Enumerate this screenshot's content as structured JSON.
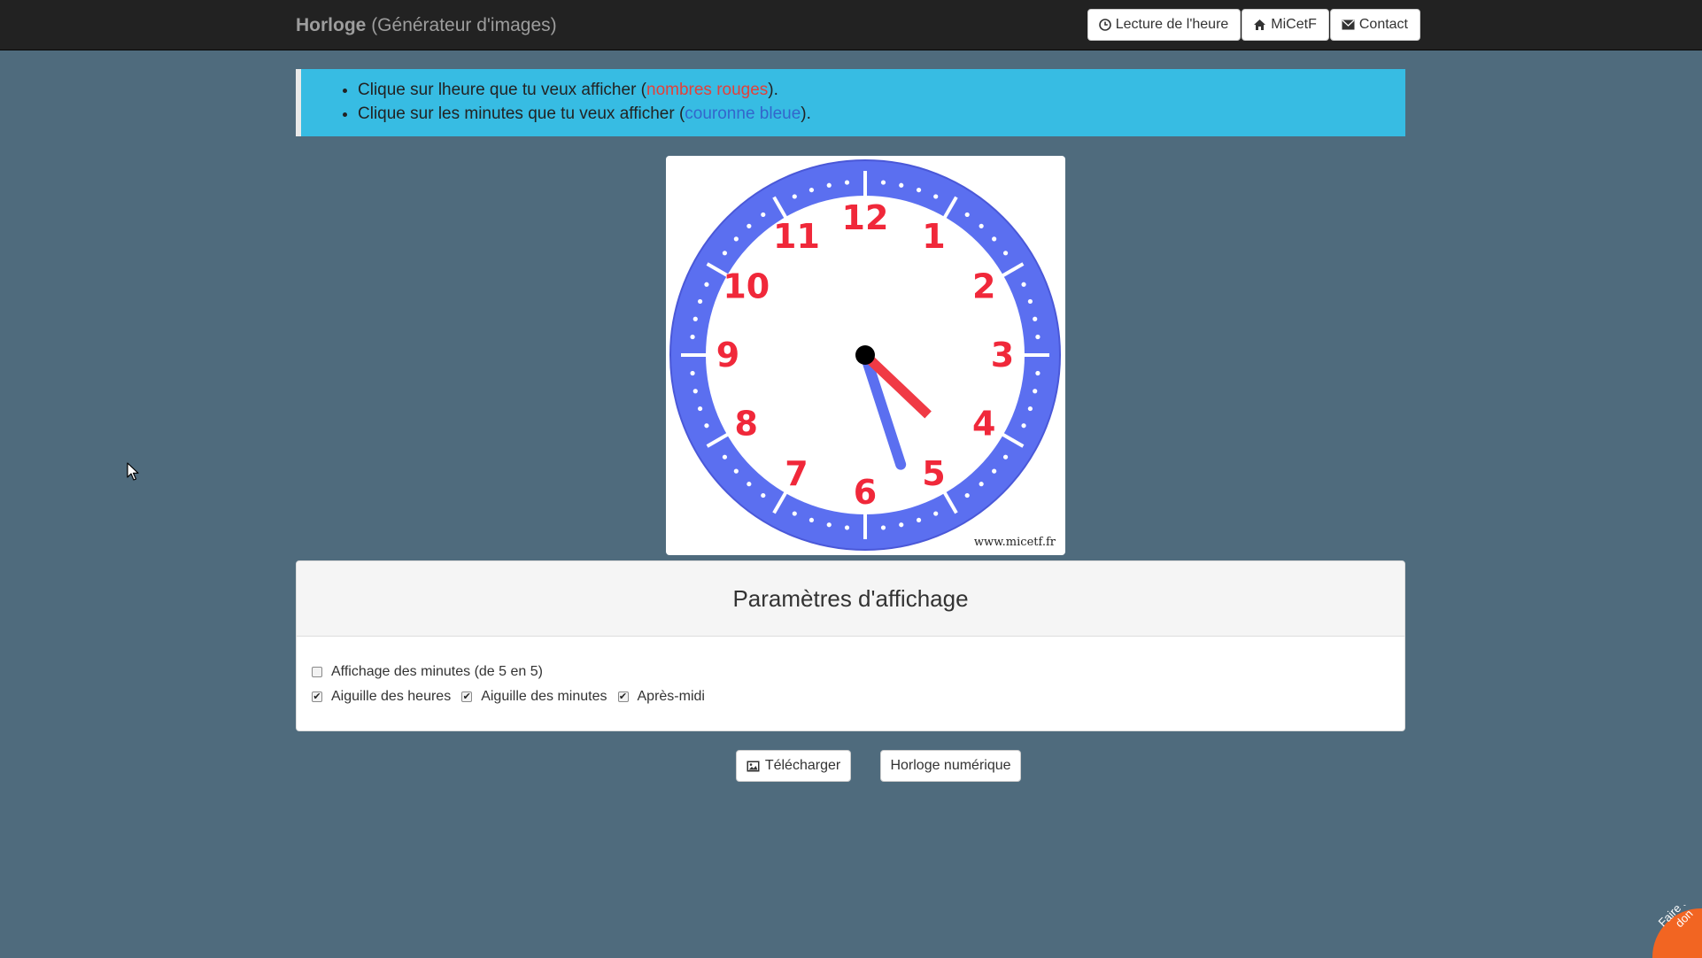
{
  "navbar": {
    "brand_main": "Horloge",
    "brand_sub": "(Générateur d'images)",
    "buttons": [
      {
        "label": "Lecture de l'heure",
        "icon": "clock-icon"
      },
      {
        "label": "MiCetF",
        "icon": "home-icon"
      },
      {
        "label": "Contact",
        "icon": "envelope-icon"
      }
    ]
  },
  "info": {
    "line1_before": "Clique sur lheure que tu veux afficher (",
    "line1_link": "nombres rouges",
    "line1_after": ").",
    "line2_before": "Clique sur les minutes que tu veux afficher (",
    "line2_link": "couronne bleue",
    "line2_after": ")."
  },
  "clock": {
    "numbers": [
      "12",
      "1",
      "2",
      "3",
      "4",
      "5",
      "6",
      "7",
      "8",
      "9",
      "10",
      "11"
    ],
    "time_hour": 4,
    "time_minute": 27,
    "watermark": "www.micetf.fr",
    "colors": {
      "ring": "#5b6ff0",
      "numbers": "#f0283a",
      "hour_hand": "#f03a45",
      "minute_hand": "#5b6ff0"
    }
  },
  "settings": {
    "title": "Paramètres d'affichage",
    "options": [
      {
        "label": "Affichage des minutes (de 5 en 5)",
        "checked": false
      },
      {
        "label": "Aiguille des heures",
        "checked": true
      },
      {
        "label": "Aiguille des minutes",
        "checked": true
      },
      {
        "label": "Après-midi",
        "checked": true
      }
    ]
  },
  "actions": {
    "download_label": "Télécharger",
    "download_icon": "image-icon",
    "digital_label": "Horloge numérique"
  },
  "donate": {
    "line1": "Faire un",
    "line2": "don"
  }
}
